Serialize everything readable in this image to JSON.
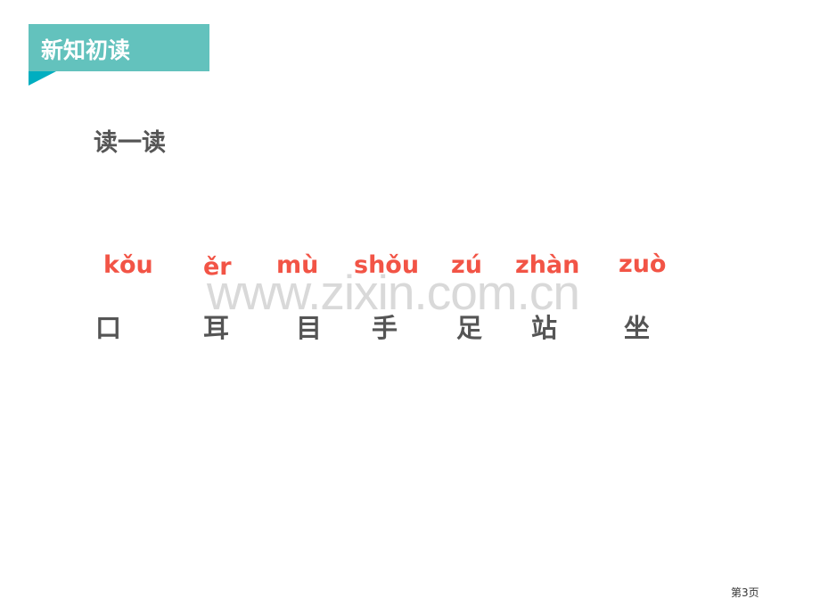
{
  "header": {
    "section_title": "新知初读",
    "accent_color": "#63c2bd",
    "fold_color": "#00aec0"
  },
  "subtitle": "读一读",
  "watermark": "www.zixin.com.cn",
  "characters": [
    {
      "pinyin": "kǒu",
      "hanzi": "口"
    },
    {
      "pinyin": "ěr",
      "hanzi": "耳"
    },
    {
      "pinyin": "mù",
      "hanzi": "目"
    },
    {
      "pinyin": "shǒu",
      "hanzi": "手"
    },
    {
      "pinyin": "zú",
      "hanzi": "足"
    },
    {
      "pinyin": "zhàn",
      "hanzi": "站"
    },
    {
      "pinyin": "zuò",
      "hanzi": "坐"
    }
  ],
  "colors": {
    "pinyin": "#f25446",
    "hanzi": "#555555"
  },
  "footer": {
    "page_label": "第3页"
  }
}
